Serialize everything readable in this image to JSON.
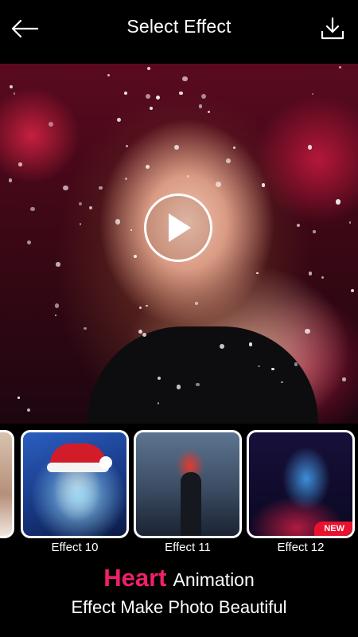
{
  "header": {
    "title": "Select Effect",
    "back_icon": "arrow-left-icon",
    "download_icon": "download-icon"
  },
  "preview": {
    "play_icon": "play-icon"
  },
  "effects": [
    {
      "label": "Effect 10",
      "badge": ""
    },
    {
      "label": "Effect 11",
      "badge": ""
    },
    {
      "label": "Effect 12",
      "badge": "NEW"
    }
  ],
  "promo": {
    "highlight": "Heart",
    "line1_rest": "Animation",
    "line2": "Effect Make Photo Beautiful"
  },
  "colors": {
    "background": "#000000",
    "accent": "#f0206a",
    "new_badge": "#e8122e"
  }
}
